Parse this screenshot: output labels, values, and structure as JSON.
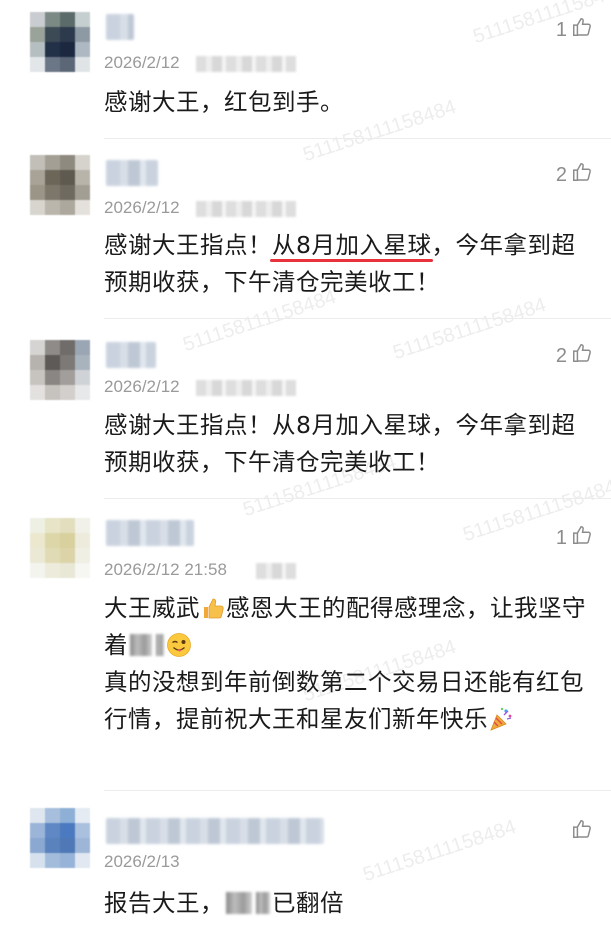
{
  "watermark": "511158111158484",
  "colors": {
    "text": "#1a1a1a",
    "meta": "#9a9a9a",
    "underline": "#e8323c",
    "divider": "#ececec"
  },
  "comments": [
    {
      "timestamp": "2026/2/12",
      "likes": "1",
      "lines": [
        "感谢大王，红包到手。"
      ]
    },
    {
      "timestamp": "2026/2/12",
      "likes": "2",
      "text_a": "感谢大王指点！",
      "text_underlined": "从8月加入星球",
      "text_b": "，今年拿到超预期收获，下午清仓完美收工！"
    },
    {
      "timestamp": "2026/2/12",
      "likes": "2",
      "lines": [
        "感谢大王指点！从8月加入星球，今年拿到超预期收获，下午清仓完美收工！"
      ]
    },
    {
      "timestamp": "2026/2/12 21:58",
      "likes": "1",
      "text_a": "大王威武",
      "text_b": "感恩大王的配得感理念，让我坚守着",
      "text_c": "真的没想到年前倒数第二个交易日还能有红包行情，提前祝大王和星友们新年快乐",
      "emoji_1": "thumbs-up-icon",
      "emoji_2": "wink-tongue-icon",
      "emoji_3": "party-popper-icon"
    },
    {
      "timestamp": "2026/2/13",
      "likes": "",
      "text_a": "报告大王，",
      "text_b": "已翻倍"
    }
  ]
}
